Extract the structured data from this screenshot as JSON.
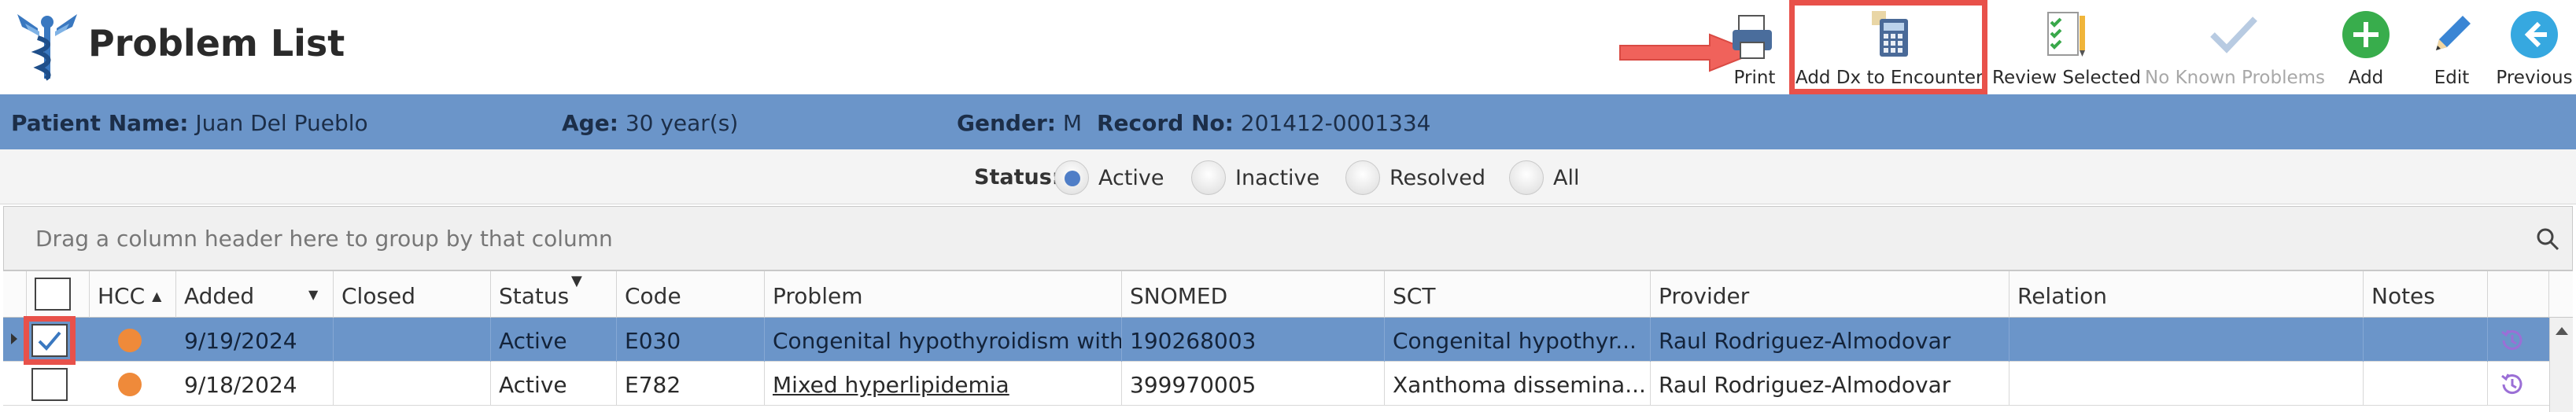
{
  "app": {
    "title": "Problem List"
  },
  "toolbar": {
    "print": "Print",
    "add_dx": "Add Dx to Encounter",
    "review_selected": "Review Selected",
    "no_known_problems": "No Known Problems",
    "add": "Add",
    "edit": "Edit",
    "previous": "Previous"
  },
  "patient": {
    "name_label": "Patient Name:",
    "name": "Juan Del Pueblo",
    "age_label": "Age:",
    "age": "30 year(s)",
    "gender_label": "Gender:",
    "gender": "M",
    "record_label": "Record No:",
    "record": "201412-0001334"
  },
  "status_filter": {
    "label": "Status:",
    "options": [
      "Active",
      "Inactive",
      "Resolved",
      "All"
    ],
    "selected": "Active"
  },
  "group_panel": {
    "text": "Drag a column header here to group by that column"
  },
  "grid": {
    "columns": [
      "HCC",
      "Added",
      "Closed",
      "Status",
      "Code",
      "Problem",
      "SNOMED",
      "SCT",
      "Provider",
      "Relation",
      "Notes"
    ],
    "rows": [
      {
        "selected": true,
        "checked": true,
        "added": "9/19/2024",
        "closed": "",
        "status": "Active",
        "code": "E030",
        "problem": "Congenital hypothyroidism with",
        "snomed": "190268003",
        "sct": "Congenital hypothyr...",
        "provider": "Raul Rodriguez-Almodovar",
        "relation": "",
        "notes": ""
      },
      {
        "selected": false,
        "checked": false,
        "added": "9/18/2024",
        "closed": "",
        "status": "Active",
        "code": "E782",
        "problem": "Mixed hyperlipidemia",
        "snomed": "399970005",
        "sct": "Xanthoma dissemina...",
        "provider": "Raul Rodriguez-Almodovar",
        "relation": "",
        "notes": ""
      }
    ]
  },
  "colors": {
    "accent": "#6b95c9",
    "highlight": "#e8514a",
    "hcc_dot": "#ef8a3a",
    "history": "#9b6fd6"
  }
}
